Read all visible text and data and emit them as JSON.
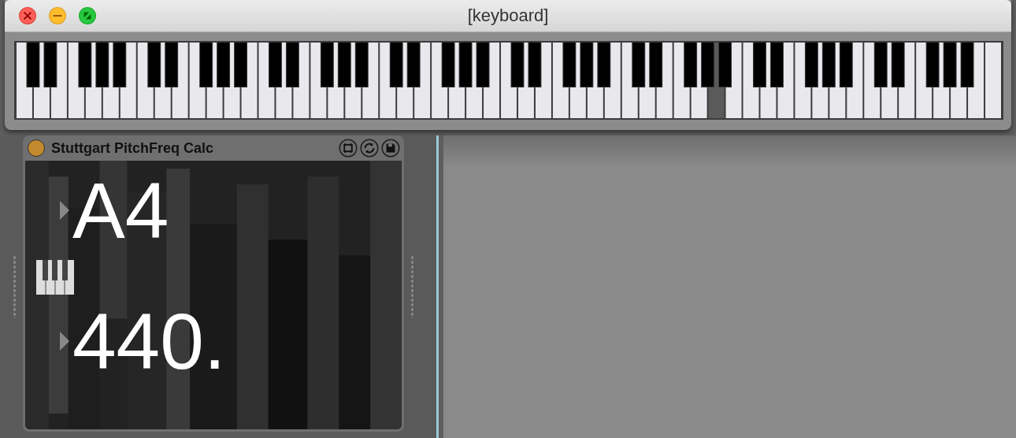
{
  "window": {
    "title": "[keyboard]"
  },
  "keyboard": {
    "keys": [
      {
        "pressed": false
      },
      {
        "pressed": false
      },
      {
        "pressed": false
      },
      {
        "pressed": false
      },
      {
        "pressed": false
      },
      {
        "pressed": false
      },
      {
        "pressed": false
      },
      {
        "pressed": false
      },
      {
        "pressed": false
      },
      {
        "pressed": false
      },
      {
        "pressed": false
      },
      {
        "pressed": false
      },
      {
        "pressed": false
      },
      {
        "pressed": false
      },
      {
        "pressed": false
      },
      {
        "pressed": false
      },
      {
        "pressed": false
      },
      {
        "pressed": false
      },
      {
        "pressed": false
      },
      {
        "pressed": false
      },
      {
        "pressed": false
      },
      {
        "pressed": false
      },
      {
        "pressed": false
      },
      {
        "pressed": false
      },
      {
        "pressed": false
      },
      {
        "pressed": false
      },
      {
        "pressed": false
      },
      {
        "pressed": false
      },
      {
        "pressed": false
      },
      {
        "pressed": false
      },
      {
        "pressed": false
      },
      {
        "pressed": false
      },
      {
        "pressed": false
      },
      {
        "pressed": false
      },
      {
        "pressed": false
      },
      {
        "pressed": false
      },
      {
        "pressed": false
      },
      {
        "pressed": false
      },
      {
        "pressed": false
      },
      {
        "pressed": false
      },
      {
        "pressed": true
      },
      {
        "pressed": false
      },
      {
        "pressed": false
      },
      {
        "pressed": false
      },
      {
        "pressed": false
      },
      {
        "pressed": false
      },
      {
        "pressed": false
      },
      {
        "pressed": false
      },
      {
        "pressed": false
      },
      {
        "pressed": false
      },
      {
        "pressed": false
      },
      {
        "pressed": false
      },
      {
        "pressed": false
      },
      {
        "pressed": false
      },
      {
        "pressed": false
      },
      {
        "pressed": false
      },
      {
        "pressed": false
      }
    ]
  },
  "device": {
    "title": "Stuttgart PitchFreq Calc",
    "on": true,
    "note": "A4",
    "frequency": "440."
  }
}
